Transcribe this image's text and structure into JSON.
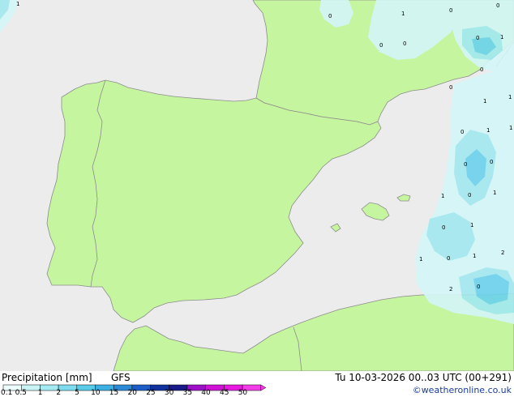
{
  "footer": {
    "title": "Precipitation [mm]",
    "model": "GFS",
    "valid_time": "Tu 10-03-2026 00..03 UTC (00+291)",
    "credit": "©weatheronline.co.uk"
  },
  "colorbar": {
    "labels": [
      "0.1",
      "0.5",
      "1",
      "2",
      "5",
      "10",
      "15",
      "20",
      "25",
      "30",
      "35",
      "40",
      "45",
      "50"
    ],
    "colors": [
      "#ecfcfc",
      "#c8f4f6",
      "#a4eaf2",
      "#7edcee",
      "#58cbe8",
      "#3cb0e2",
      "#2a8ad6",
      "#1c5ec6",
      "#12339e",
      "#1a1a88",
      "#9c10c8",
      "#d012d6",
      "#e81ae0",
      "#f23ce8"
    ]
  },
  "map": {
    "colors": {
      "sea": "#ececec",
      "land": "#c6f5a0",
      "border": "#8c8c8c",
      "precip_light": "#d4f6f8",
      "precip_mid": "#a2e8f0",
      "precip_heavy": "#6cd2ec"
    },
    "precip_labels": [
      "1",
      "0",
      "1",
      "0",
      "0",
      "0",
      "0",
      "1",
      "0",
      "0",
      "1",
      "0",
      "1",
      "0",
      "1",
      "1",
      "0",
      "0",
      "1",
      "0",
      "1",
      "0",
      "1",
      "1",
      "0",
      "1",
      "2",
      "2",
      "0"
    ]
  }
}
